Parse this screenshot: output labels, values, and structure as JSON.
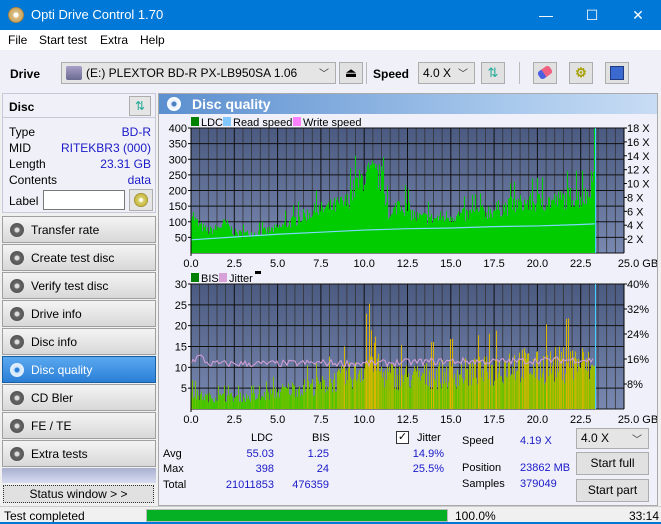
{
  "window": {
    "title": "Opti Drive Control 1.70",
    "minimize": "—",
    "maximize": "☐",
    "close": "✕"
  },
  "menu": [
    "File",
    "Start test",
    "Extra",
    "Help"
  ],
  "toolbar": {
    "drive_label": "Drive",
    "drive_value": "(E:)  PLEXTOR BD-R  PX-LB950SA 1.06",
    "speed_label": "Speed",
    "speed_value": "4.0 X",
    "icons": [
      "drive-icon",
      "eject-icon",
      "refresh-icon",
      "erase-icon",
      "settings-icon",
      "save-icon"
    ]
  },
  "disc": {
    "header": "Disc",
    "fields": [
      {
        "key": "Type",
        "value": "BD-R"
      },
      {
        "key": "MID",
        "value": "RITEKBR3 (000)"
      },
      {
        "key": "Length",
        "value": "23.31 GB"
      },
      {
        "key": "Contents",
        "value": "data"
      }
    ],
    "label_key": "Label",
    "label_value": ""
  },
  "nav": [
    {
      "label": "Transfer rate",
      "active": false
    },
    {
      "label": "Create test disc",
      "active": false
    },
    {
      "label": "Verify test disc",
      "active": false
    },
    {
      "label": "Drive info",
      "active": false
    },
    {
      "label": "Disc info",
      "active": false
    },
    {
      "label": "Disc quality",
      "active": true
    },
    {
      "label": "CD Bler",
      "active": false
    },
    {
      "label": "FE / TE",
      "active": false
    },
    {
      "label": "Extra tests",
      "active": false
    }
  ],
  "status_window_button": "Status window > >",
  "panel": {
    "title": "Disc quality"
  },
  "chart_data": [
    {
      "type": "area",
      "title": "LDC",
      "legend": [
        {
          "name": "LDC",
          "color": "#008000"
        },
        {
          "name": "Read speed",
          "color": "#80c8ff"
        },
        {
          "name": "Write speed",
          "color": "#ff80ff"
        }
      ],
      "legend_position": "top-left",
      "xlabel": "GB",
      "xlim": [
        0,
        25
      ],
      "x_ticks": [
        "0.0",
        "2.5",
        "5.0",
        "7.5",
        "10.0",
        "12.5",
        "15.0",
        "17.5",
        "20.0",
        "22.5",
        "25.0 GB"
      ],
      "ylim": [
        0,
        400
      ],
      "y_ticks": [
        "50",
        "100",
        "150",
        "200",
        "250",
        "300",
        "350",
        "400"
      ],
      "y2lim": [
        0,
        18
      ],
      "y2_ticks": [
        "2 X",
        "4 X",
        "6 X",
        "8 X",
        "10 X",
        "12 X",
        "14 X",
        "16 X",
        "18 X"
      ],
      "grid": true,
      "series": [
        {
          "name": "LDC",
          "x": [
            0.0,
            0.25,
            0.5,
            1.0,
            1.5,
            2.0,
            2.5,
            3.0,
            4.0,
            5.0,
            6.0,
            7.0,
            8.0,
            9.0,
            9.5,
            10.0,
            10.5,
            11.0,
            11.5,
            12.0,
            12.5,
            13.0,
            14.0,
            15.0,
            16.0,
            17.0,
            18.0,
            19.0,
            20.0,
            21.0,
            22.0,
            22.5,
            23.0,
            23.31
          ],
          "values": [
            160,
            120,
            100,
            80,
            90,
            110,
            75,
            70,
            75,
            90,
            120,
            150,
            165,
            185,
            240,
            280,
            290,
            270,
            120,
            190,
            160,
            130,
            125,
            135,
            140,
            150,
            165,
            180,
            185,
            190,
            205,
            200,
            210,
            398
          ]
        },
        {
          "name": "Read speed",
          "x": [
            0.0,
            2.5,
            5.0,
            7.5,
            10.0,
            12.5,
            15.0,
            17.5,
            20.0,
            22.5,
            23.31
          ],
          "values": [
            1.9,
            2.3,
            2.7,
            3.0,
            3.3,
            3.5,
            3.6,
            3.8,
            3.9,
            4.1,
            4.19
          ]
        }
      ]
    },
    {
      "type": "area",
      "title": "BIS",
      "legend": [
        {
          "name": "BIS",
          "color": "#008000"
        },
        {
          "name": "Jitter",
          "color": "#d8a0d8"
        }
      ],
      "legend_position": "top-left",
      "xlabel": "GB",
      "xlim": [
        0,
        25
      ],
      "x_ticks": [
        "0.0",
        "2.5",
        "5.0",
        "7.5",
        "10.0",
        "12.5",
        "15.0",
        "17.5",
        "20.0",
        "22.5",
        "25.0 GB"
      ],
      "ylim": [
        0,
        30
      ],
      "y_ticks": [
        "5",
        "10",
        "15",
        "20",
        "25",
        "30"
      ],
      "y2lim": [
        0,
        40
      ],
      "y2_ticks": [
        "8%",
        "16%",
        "24%",
        "32%",
        "40%"
      ],
      "grid": true,
      "series": [
        {
          "name": "BIS",
          "x": [
            0.0,
            1.0,
            2.5,
            4.0,
            5.0,
            6.0,
            7.5,
            8.5,
            9.5,
            10.0,
            10.5,
            11.0,
            12.0,
            13.0,
            15.0,
            17.5,
            18.5,
            20.0,
            21.0,
            22.5,
            23.31
          ],
          "values": [
            5,
            4,
            4,
            4,
            6,
            7,
            8,
            10,
            12,
            15,
            20,
            12,
            11,
            11,
            12,
            13,
            16,
            14,
            15,
            16,
            13
          ]
        },
        {
          "name": "Jitter",
          "x": [
            0.0,
            0.5,
            1.0,
            2.5,
            5.0,
            7.5,
            10.0,
            12.5,
            15.0,
            17.5,
            20.0,
            22.5,
            23.31
          ],
          "values": [
            15,
            17,
            14.5,
            14.5,
            14.5,
            14.8,
            14.5,
            15.0,
            15.3,
            15.2,
            15.5,
            15.8,
            15.5
          ]
        }
      ]
    }
  ],
  "stats": {
    "col_ldc": "LDC",
    "col_bis": "BIS",
    "jitter_label": "Jitter",
    "jitter_checked": true,
    "rows": [
      {
        "label": "Avg",
        "ldc": "55.03",
        "bis": "1.25",
        "jitter": "14.9%"
      },
      {
        "label": "Max",
        "ldc": "398",
        "bis": "24",
        "jitter": "25.5%"
      },
      {
        "label": "Total",
        "ldc": "21011853",
        "bis": "476359",
        "jitter": ""
      }
    ],
    "speed_label": "Speed",
    "speed_value": "4.19 X",
    "position_label": "Position",
    "position_value": "23862 MB",
    "samples_label": "Samples",
    "samples_value": "379049",
    "speed_select": "4.0 X",
    "start_full": "Start full",
    "start_part": "Start part"
  },
  "statusbar": {
    "text": "Test completed",
    "progress": 100.0,
    "progress_text": "100.0%",
    "time": "33:14"
  }
}
